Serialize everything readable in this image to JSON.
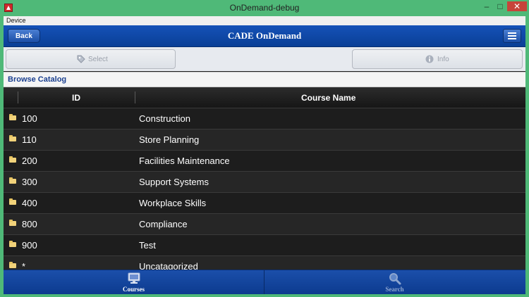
{
  "window": {
    "title": "OnDemand-debug",
    "menu": "Device"
  },
  "header": {
    "back_label": "Back",
    "title": "CADE OnDemand"
  },
  "toolbar": {
    "select_label": "Select",
    "info_label": "Info"
  },
  "section": {
    "title": "Browse Catalog"
  },
  "table": {
    "columns": [
      "ID",
      "Course Name"
    ],
    "rows": [
      {
        "id": "100",
        "name": "Construction"
      },
      {
        "id": "110",
        "name": "Store Planning"
      },
      {
        "id": "200",
        "name": "Facilities Maintenance"
      },
      {
        "id": "300",
        "name": "Support Systems"
      },
      {
        "id": "400",
        "name": "Workplace Skills"
      },
      {
        "id": "800",
        "name": "Compliance"
      },
      {
        "id": "900",
        "name": "Test"
      },
      {
        "id": "*",
        "name": "Uncatagorized"
      }
    ]
  },
  "tabs": {
    "courses_label": "Courses",
    "search_label": "Search"
  },
  "icons": {
    "app": "app-icon",
    "menu": "menu-icon",
    "select": "tag-icon",
    "info": "info-icon",
    "folder": "folder-icon",
    "courses": "monitor-icon",
    "search": "magnifier-icon"
  },
  "colors": {
    "window_frame": "#4fb978",
    "header": "#0a3f96",
    "close": "#c7443a"
  }
}
